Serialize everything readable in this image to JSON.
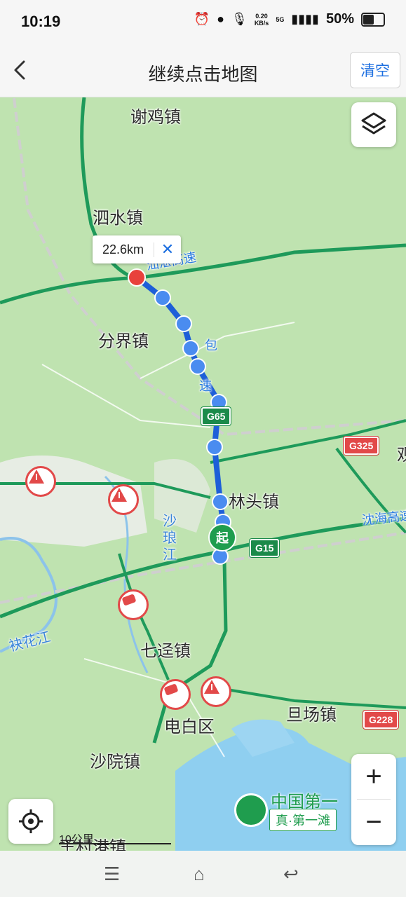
{
  "status_bar": {
    "time": "10:19",
    "net_speed_value": "0.20",
    "net_speed_unit": "KB/s",
    "network": "5G",
    "battery": "50%"
  },
  "header": {
    "title": "继续点击地图",
    "clear_label": "清空"
  },
  "map": {
    "distance_popup": "22.6km",
    "start_label": "起",
    "scale_label": "10公里",
    "place_labels": {
      "xieji": "谢鸡镇",
      "sishui": "泗水镇",
      "fenjie": "分界镇",
      "lintou": "林头镇",
      "qijing": "七迳镇",
      "dianbai": "电白区",
      "danchang": "旦场镇",
      "shayuan": "沙院镇",
      "wangcun": "王村港镇",
      "edge_char": "观"
    },
    "road_labels": {
      "shanzhan": "汕湛高速",
      "baomao_1": "包",
      "baomao_2": "速",
      "shenhai": "沈海高速"
    },
    "water_labels": {
      "shalang_1": "沙",
      "shalang_2": "琅",
      "shalang_3": "江",
      "jiaohua": "袂花江"
    },
    "shields": {
      "g65": "G65",
      "g325": "G325",
      "g15": "G15",
      "g228": "G228"
    },
    "poi": {
      "name": "中国第一",
      "sub": "真·第一滩"
    }
  },
  "colors": {
    "map_bg": "#bfe3b0",
    "route": "#1d5fd8",
    "highway": "#1e9a5a",
    "accent": "#1d6fe0",
    "alert_red": "#e24949"
  },
  "icons": {
    "back": "chevron-left-icon",
    "layers": "layers-icon",
    "locate": "locate-icon",
    "zoom_in": "plus-icon",
    "zoom_out": "minus-icon"
  },
  "navbar": {
    "menu": "☰",
    "home": "⌂",
    "back": "↩"
  }
}
